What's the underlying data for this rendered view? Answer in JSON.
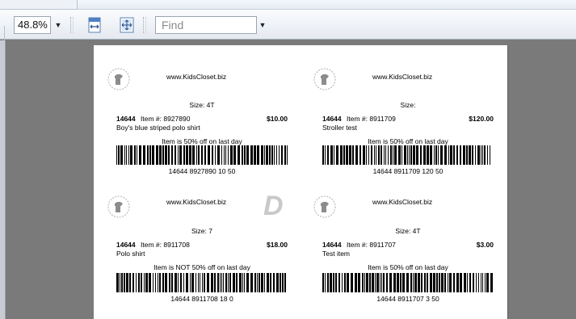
{
  "toolbar": {
    "zoom_value": "48.8%",
    "find_placeholder": "Find",
    "icons": [
      "fit-width-icon",
      "fit-page-icon"
    ]
  },
  "labels": [
    {
      "website": "www.KidsCloset.biz",
      "size": "Size: 4T",
      "sku": "14644",
      "item": "Item #: 8927890",
      "price": "$10.00",
      "description": "Boy's blue striped polo shirt",
      "discount": "Item is 50% off on last day",
      "barcode_text": "14644 8927890 10 50"
    },
    {
      "website": "www.KidsCloset.biz",
      "size": "Size:",
      "sku": "14644",
      "item": "Item #: 8911709",
      "price": "$120.00",
      "description": "Stroller test",
      "discount": "Item is 50% off on last day",
      "barcode_text": "14644 8911709 120 50"
    },
    {
      "website": "www.KidsCloset.biz",
      "size": "Size: 7",
      "sku": "14644",
      "item": "Item #: 8911708",
      "price": "$18.00",
      "description": "Polo shirt",
      "discount": "Item is NOT 50% off on last day",
      "barcode_text": "14644 8911708 18 0",
      "mark": "D"
    },
    {
      "website": "www.KidsCloset.biz",
      "size": "Size: 4T",
      "sku": "14644",
      "item": "Item #: 8911707",
      "price": "$3.00",
      "description": "Test item",
      "discount": "Item is 50% off on last day",
      "barcode_text": "14644 8911707 3 50"
    }
  ],
  "colors": {
    "viewer_background": "#7a7a7a",
    "page": "#ffffff",
    "toolbar": "#eef2f7"
  }
}
